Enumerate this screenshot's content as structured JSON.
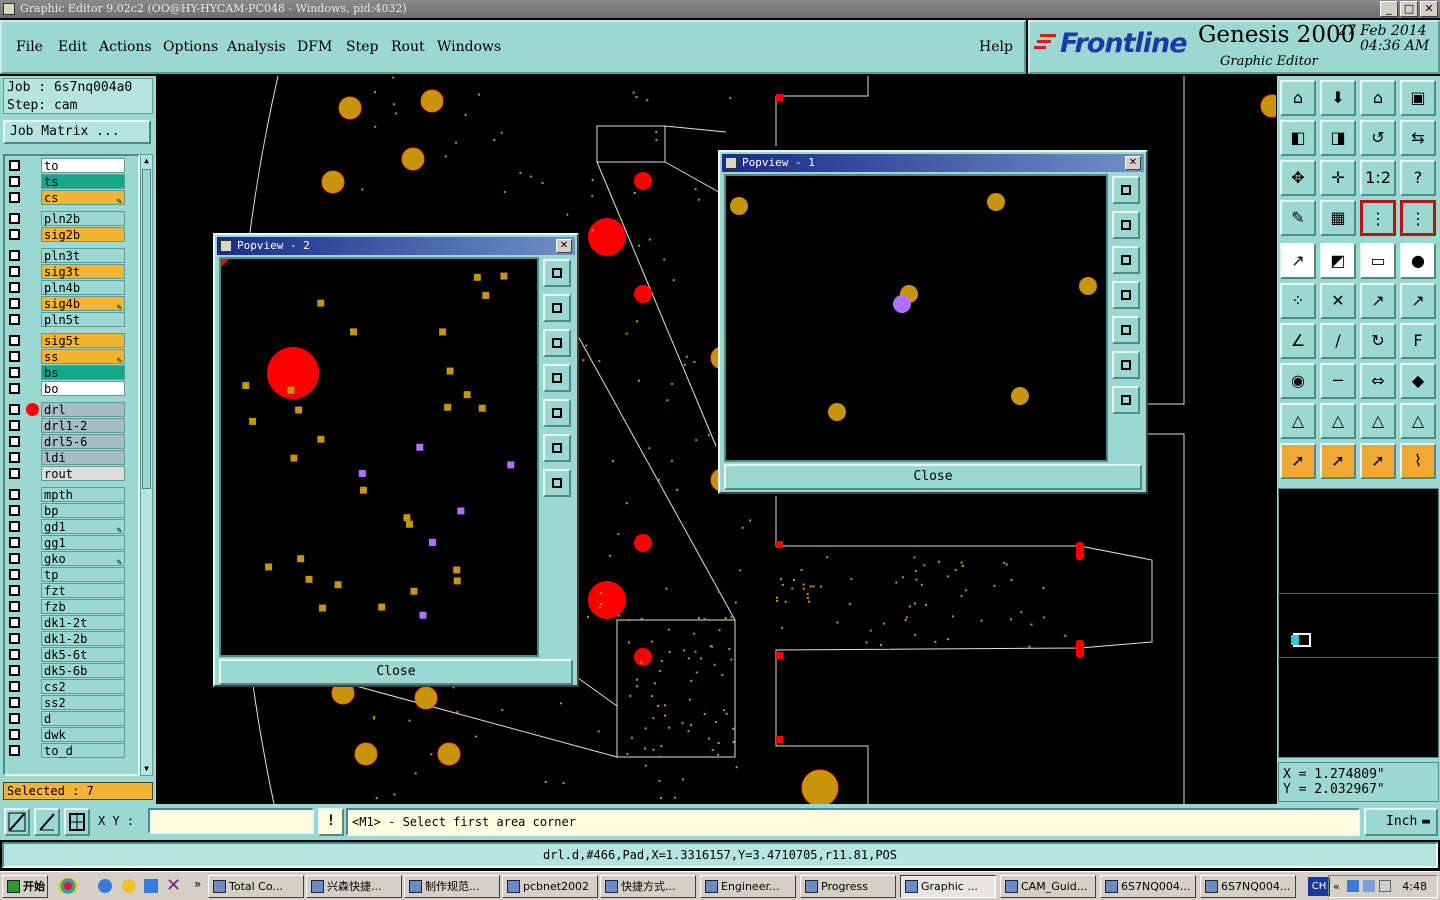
{
  "window": {
    "title": "Graphic Editor 9.02c2 (OO@HY-HYCAM-PC048 - Windows, pid:4032)",
    "minimize": "_",
    "maximize": "□",
    "close": "✕"
  },
  "menu": [
    {
      "label": "File"
    },
    {
      "label": "Edit"
    },
    {
      "label": "Actions"
    },
    {
      "label": "Options"
    },
    {
      "label": "Analysis"
    },
    {
      "label": "DFM"
    },
    {
      "label": "Step"
    },
    {
      "label": "Rout"
    },
    {
      "label": "Windows"
    }
  ],
  "help": "Help",
  "brand": {
    "logo": "Frontline",
    "title": "Genesis 2000",
    "subtitle": "Graphic Editor",
    "date": "27 Feb 2014",
    "time": "04:36 AM"
  },
  "job": {
    "job_line": "Job : 6s7nq004a0",
    "step_line": "Step: cam",
    "matrix_button": "Job Matrix ..."
  },
  "layers": [
    {
      "name": "to",
      "color": "#ffffff"
    },
    {
      "name": "ts",
      "color": "#13a88c"
    },
    {
      "name": "cs",
      "color": "#f2b432",
      "edit": "✎"
    },
    {
      "name": "pln2b",
      "color": "#9cd7d2"
    },
    {
      "name": "sig2b",
      "color": "#f2b432"
    },
    {
      "name": "pln3t",
      "color": "#9cd7d2"
    },
    {
      "name": "sig3t",
      "color": "#f2b432"
    },
    {
      "name": "pln4b",
      "color": "#9cd7d2"
    },
    {
      "name": "sig4b",
      "color": "#f2b432",
      "edit": "✎"
    },
    {
      "name": "pln5t",
      "color": "#9cd7d2"
    },
    {
      "name": "sig5t",
      "color": "#f2b432"
    },
    {
      "name": "ss",
      "color": "#f2b432",
      "edit": "✎"
    },
    {
      "name": "bs",
      "color": "#13a88c"
    },
    {
      "name": "bo",
      "color": "#ffffff"
    },
    {
      "name": "drl",
      "color": "#a8bcc8",
      "active": true
    },
    {
      "name": "drl1-2",
      "color": "#a8bcc8"
    },
    {
      "name": "drl5-6",
      "color": "#a8bcc8"
    },
    {
      "name": "ldi",
      "color": "#a8bcc8"
    },
    {
      "name": "rout",
      "color": "#dcdcdc"
    },
    {
      "name": "mpth",
      "color": "#9cd7d2"
    },
    {
      "name": "bp",
      "color": "#9cd7d2"
    },
    {
      "name": "gd1",
      "color": "#9cd7d2",
      "edit": "✎"
    },
    {
      "name": "gg1",
      "color": "#9cd7d2"
    },
    {
      "name": "gko",
      "color": "#9cd7d2",
      "edit": "✎"
    },
    {
      "name": "tp",
      "color": "#9cd7d2"
    },
    {
      "name": "fzt",
      "color": "#9cd7d2"
    },
    {
      "name": "fzb",
      "color": "#9cd7d2"
    },
    {
      "name": "dk1-2t",
      "color": "#9cd7d2"
    },
    {
      "name": "dk1-2b",
      "color": "#9cd7d2"
    },
    {
      "name": "dk5-6t",
      "color": "#9cd7d2"
    },
    {
      "name": "dk5-6b",
      "color": "#9cd7d2"
    },
    {
      "name": "cs2",
      "color": "#9cd7d2"
    },
    {
      "name": "ss2",
      "color": "#9cd7d2"
    },
    {
      "name": "d",
      "color": "#9cd7d2"
    },
    {
      "name": "dwk",
      "color": "#9cd7d2"
    },
    {
      "name": "to_d",
      "color": "#9cd7d2"
    }
  ],
  "selected": "Selected : 7",
  "popview1": {
    "title": "Popview - 1",
    "close": "Close",
    "x": "✕"
  },
  "popview2": {
    "title": "Popview - 2",
    "close": "Close",
    "x": "✕"
  },
  "coords": {
    "x": "X = 1.274809\"",
    "y": "Y = 2.032967\""
  },
  "cmd": {
    "xy_label": "X Y :",
    "xy_value": "",
    "alert": "!",
    "prompt": "<M1> - Select first area corner",
    "units": "Inch"
  },
  "status": "drl.d,#466,Pad,X=1.3316157,Y=3.4710705,r11.81,POS",
  "taskbar": {
    "start": "开始",
    "tasks": [
      {
        "label": "Total Co..."
      },
      {
        "label": "兴森快捷..."
      },
      {
        "label": "制作规范..."
      },
      {
        "label": "pcbnet2002"
      },
      {
        "label": "快捷方式..."
      },
      {
        "label": "Engineer..."
      },
      {
        "label": "Progress"
      },
      {
        "label": "Graphic ...",
        "active": true
      },
      {
        "label": "CAM_Guid..."
      },
      {
        "label": "6S7NQ004..."
      },
      {
        "label": "6S7NQ004..."
      }
    ],
    "lang": "CH",
    "clock": "4:48"
  },
  "colors": {
    "pad": "#c8940c",
    "drill_red": "#ff0000",
    "purple": "#b070ff",
    "panel": "#9cd7d2"
  }
}
